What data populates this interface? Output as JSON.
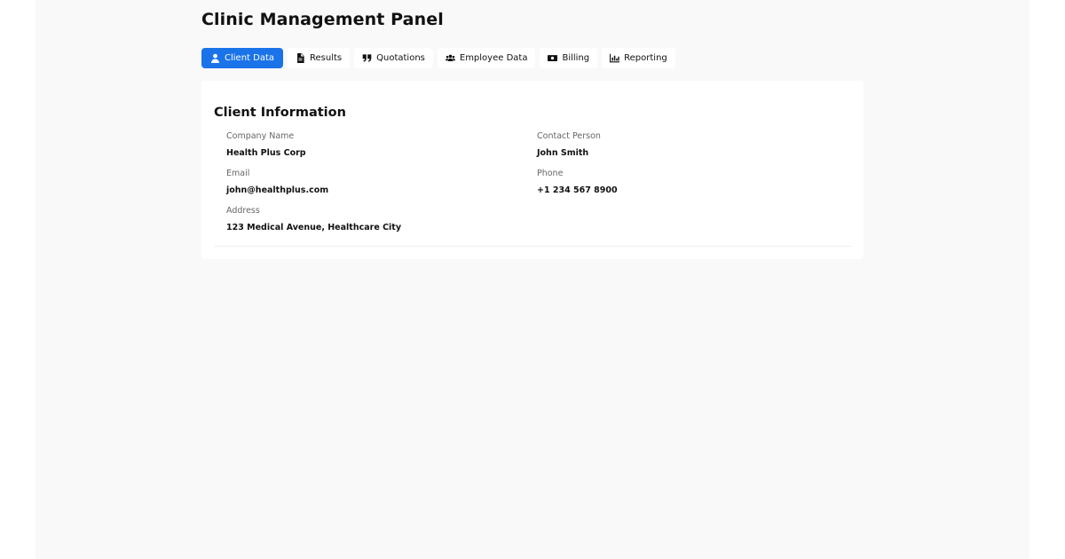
{
  "header": {
    "title": "Clinic Management Panel"
  },
  "tabs": [
    {
      "label": "Client Data",
      "icon": "user-icon",
      "active": true
    },
    {
      "label": "Results",
      "icon": "file-icon",
      "active": false
    },
    {
      "label": "Quotations",
      "icon": "quote-icon",
      "active": false
    },
    {
      "label": "Employee Data",
      "icon": "users-icon",
      "active": false
    },
    {
      "label": "Billing",
      "icon": "money-bill-icon",
      "active": false
    },
    {
      "label": "Reporting",
      "icon": "chart-icon",
      "active": false
    }
  ],
  "client_info": {
    "title": "Client Information",
    "company_name": {
      "label": "Company Name",
      "value": "Health Plus Corp"
    },
    "contact_person": {
      "label": "Contact Person",
      "value": "John Smith"
    },
    "email": {
      "label": "Email",
      "value": "john@healthplus.com"
    },
    "phone": {
      "label": "Phone",
      "value": "+1 234 567 8900"
    },
    "address": {
      "label": "Address",
      "value": "123 Medical Avenue, Healthcare City"
    }
  },
  "colors": {
    "accent": "#1a73e8",
    "background": "#f9f9f9",
    "card": "#ffffff",
    "label": "#666666"
  }
}
